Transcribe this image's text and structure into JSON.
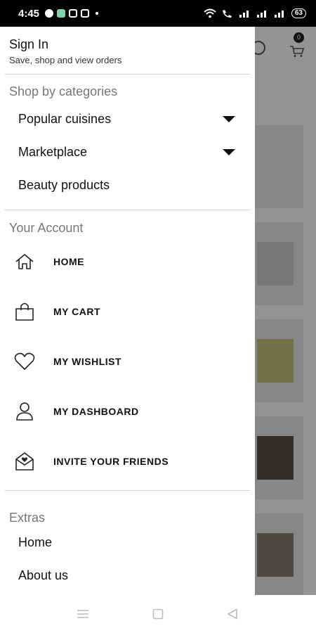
{
  "status": {
    "time": "4:45",
    "battery": "63"
  },
  "background": {
    "cart_count": "0"
  },
  "drawer": {
    "signin": {
      "title": "Sign In",
      "subtitle": "Save, shop and view orders"
    },
    "categories": {
      "title": "Shop by categories",
      "items": [
        {
          "label": "Popular cuisines",
          "expandable": true
        },
        {
          "label": "Marketplace",
          "expandable": true
        },
        {
          "label": "Beauty products",
          "expandable": false
        }
      ]
    },
    "account": {
      "title": "Your Account",
      "items": [
        {
          "label": "HOME",
          "icon": "home-icon"
        },
        {
          "label": "MY CART",
          "icon": "shopping-bag-icon"
        },
        {
          "label": "MY WISHLIST",
          "icon": "heart-icon"
        },
        {
          "label": "MY DASHBOARD",
          "icon": "user-icon"
        },
        {
          "label": "INVITE YOUR FRIENDS",
          "icon": "envelope-heart-icon"
        }
      ]
    },
    "extras": {
      "title": "Extras",
      "items": [
        {
          "label": "Home"
        },
        {
          "label": "About us"
        }
      ]
    }
  }
}
